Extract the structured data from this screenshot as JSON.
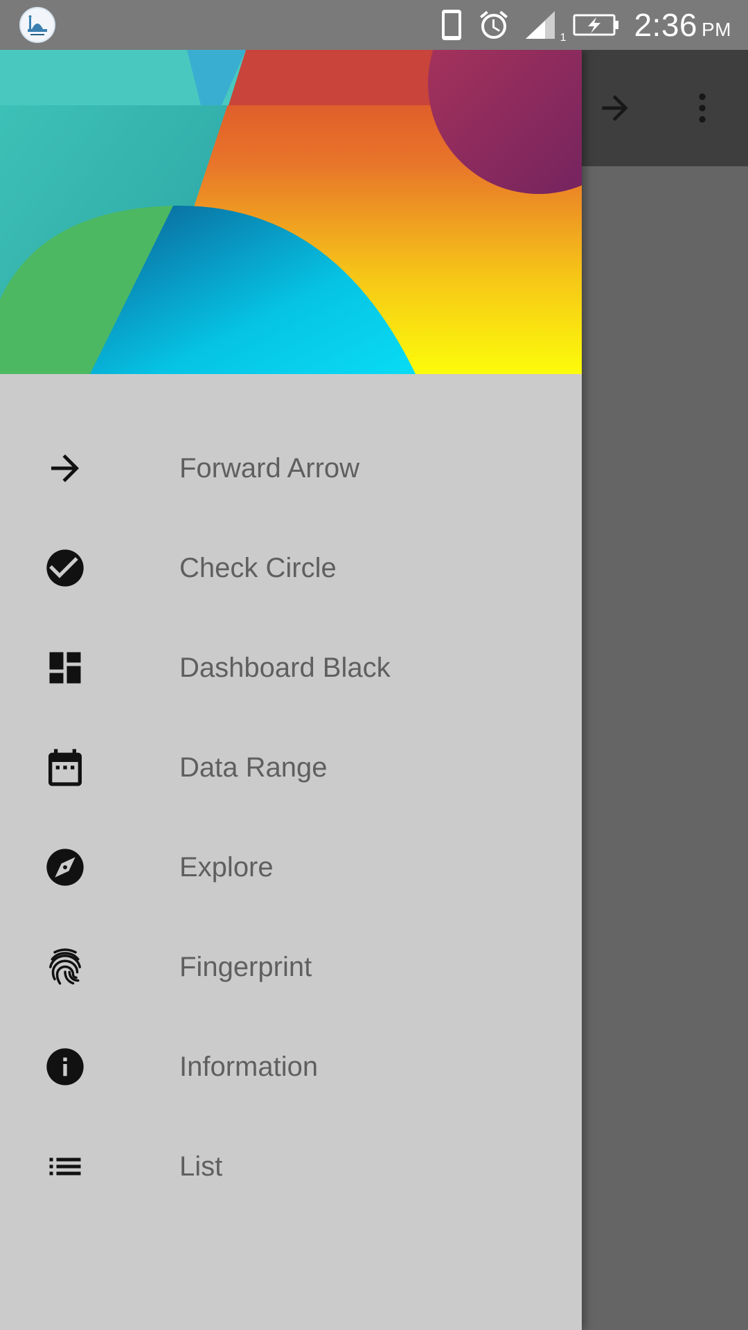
{
  "status_bar": {
    "time": "2:36",
    "ampm": "PM",
    "signal_sim": "1",
    "icons": [
      "app-mosque-icon",
      "phone-icon",
      "alarm-icon",
      "signal-icon",
      "battery-charging-icon"
    ]
  },
  "toolbar": {
    "actions": [
      "forward-arrow-icon",
      "overflow-menu-icon"
    ]
  },
  "drawer": {
    "menu": [
      {
        "label": "Forward Arrow",
        "icon": "forward-arrow-icon"
      },
      {
        "label": "Check Circle",
        "icon": "check-circle-icon"
      },
      {
        "label": "Dashboard Black",
        "icon": "dashboard-icon"
      },
      {
        "label": "Data Range",
        "icon": "calendar-icon"
      },
      {
        "label": "Explore",
        "icon": "explore-icon"
      },
      {
        "label": "Fingerprint",
        "icon": "fingerprint-icon"
      },
      {
        "label": "Information",
        "icon": "info-icon"
      },
      {
        "label": "List",
        "icon": "list-icon"
      }
    ]
  },
  "colors": {
    "drawer_bg": "#cbcbcb",
    "label": "#5f5f5f",
    "icon": "#111111",
    "scrim": "#666666",
    "status_bar": "#7a7a7a"
  }
}
